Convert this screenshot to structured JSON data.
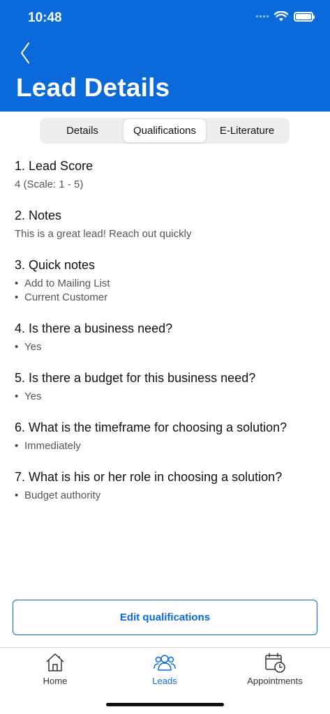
{
  "status_bar": {
    "time": "10:48"
  },
  "header": {
    "title": "Lead Details"
  },
  "segments": [
    {
      "label": "Details",
      "active": false
    },
    {
      "label": "Qualifications",
      "active": true
    },
    {
      "label": "E-Literature",
      "active": false
    }
  ],
  "questions": [
    {
      "title": "1. Lead Score",
      "value": "4 (Scale: 1 - 5)"
    },
    {
      "title": "2. Notes",
      "value": "This is a great lead! Reach out quickly"
    },
    {
      "title": "3. Quick notes",
      "bullets": [
        "Add to Mailing List",
        "Current Customer"
      ]
    },
    {
      "title": "4. Is there a business need?",
      "bullets": [
        "Yes"
      ]
    },
    {
      "title": "5. Is there a budget for this business need?",
      "bullets": [
        "Yes"
      ]
    },
    {
      "title": "6. What is the timeframe for choosing a solution?",
      "bullets": [
        "Immediately"
      ]
    },
    {
      "title": "7. What is his or her role in choosing a solution?",
      "bullets": [
        "Budget authority"
      ]
    }
  ],
  "edit_button": {
    "label": "Edit qualifications"
  },
  "tabbar": {
    "items": [
      {
        "label": "Home",
        "icon": "home-icon",
        "active": false
      },
      {
        "label": "Leads",
        "icon": "leads-icon",
        "active": true
      },
      {
        "label": "Appointments",
        "icon": "calendar-clock-icon",
        "active": false
      }
    ]
  },
  "colors": {
    "brand": "#0a6ad9",
    "segment_bg": "#eeeeef"
  }
}
